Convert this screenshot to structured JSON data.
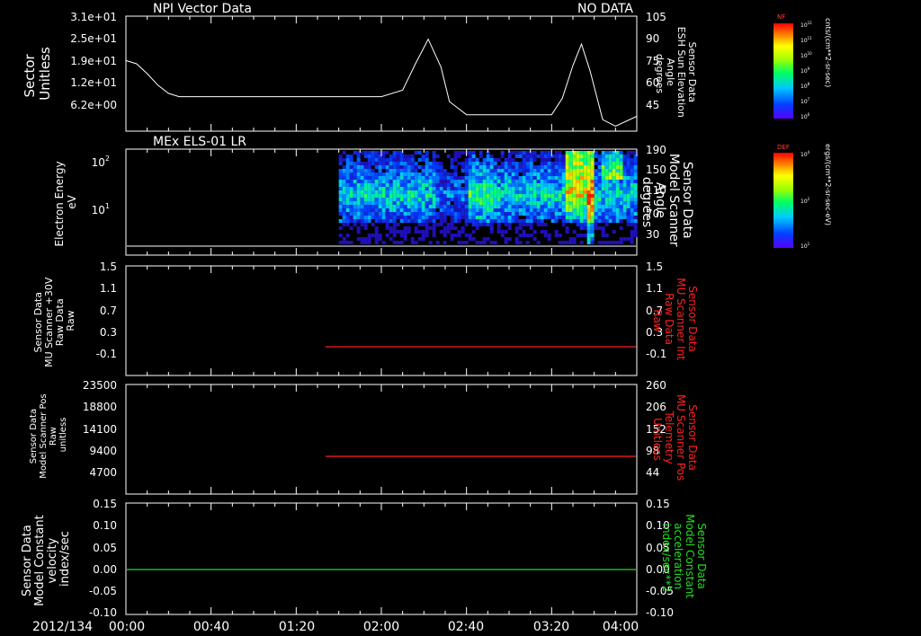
{
  "date_label": "2012/134",
  "time_ticks": [
    "00:00",
    "00:40",
    "01:20",
    "02:00",
    "02:40",
    "03:20",
    "04:00"
  ],
  "colors": {
    "background": "#000000",
    "foreground": "#ffffff",
    "red": "#ff2020",
    "green": "#20e020"
  },
  "panels": [
    {
      "id": "sector",
      "title_left": "NPI Vector Data",
      "title_right": "NO DATA",
      "ylabel_left": [
        "Sector",
        "Unitless"
      ],
      "ylabel_right": [
        "Sensor Data",
        "ESH Sun Elevation",
        "Angle",
        "degrees"
      ],
      "left_ticks": [
        "3.1e+01",
        "2.5e+01",
        "1.9e+01",
        "1.2e+01",
        "6.2e+00"
      ],
      "right_ticks": [
        "105",
        "90",
        "75",
        "60",
        "45"
      ]
    },
    {
      "id": "els",
      "title_left": "MEx ELS-01 LR",
      "ylabel_left": [
        "Electron Energy",
        "eV"
      ],
      "ylabel_right": [
        "Sensor Data",
        "Model Scanner",
        "Angle",
        "degrees"
      ],
      "left_ticks": [
        "10",
        "10"
      ],
      "left_tick_exponents": [
        "2",
        "1"
      ],
      "right_ticks": [
        "190",
        "150",
        "110",
        "70",
        "30"
      ]
    },
    {
      "id": "mu_raw",
      "ylabel_left": [
        "Sensor Data",
        "MU Scanner +30V",
        "Raw Data",
        "Raw"
      ],
      "ylabel_right": [
        "Sensor Data",
        "MU Scanner Int",
        "Raw Data",
        "Raw"
      ],
      "left_ticks": [
        "1.5",
        "1.1",
        "0.7",
        "0.3",
        "-0.1"
      ],
      "right_ticks": [
        "1.5",
        "1.1",
        "0.7",
        "0.3",
        "-0.1"
      ]
    },
    {
      "id": "pos",
      "ylabel_left": [
        "Sensor Data",
        "Model Scanner Pos",
        "Raw",
        "unitless"
      ],
      "ylabel_right": [
        "Sensor Data",
        "MU Scanner Pos",
        "Telemetry",
        "Unitless"
      ],
      "left_ticks": [
        "23500",
        "18800",
        "14100",
        "9400",
        "4700"
      ],
      "right_ticks": [
        "260",
        "206",
        "152",
        "98",
        "44"
      ]
    },
    {
      "id": "constant",
      "ylabel_left": [
        "Sensor Data",
        "Model Constant",
        "velocity",
        "index/sec"
      ],
      "ylabel_right": [
        "Sensor Data",
        "Model Constant",
        "acceleration",
        "index/sec**2"
      ],
      "left_ticks": [
        "0.15",
        "0.10",
        "0.05",
        "0.00",
        "-0.05",
        "-0.10"
      ],
      "right_ticks": [
        "0.15",
        "0.10",
        "0.05",
        "0.00",
        "-0.05",
        "-0.10"
      ]
    }
  ],
  "colorbars": [
    {
      "id": "nf",
      "label": "NF",
      "unit": "cnts/(cm**2-sr-sec)",
      "ticks": [
        "10",
        "10",
        "10",
        "10",
        "10",
        "10",
        "10"
      ],
      "tick_exponents": [
        "12",
        "11",
        "10",
        "9",
        "8",
        "7",
        "6"
      ]
    },
    {
      "id": "def",
      "label": "DEF",
      "unit": "ergs/(cm**2-sr-sec-eV)",
      "ticks": [
        "10",
        "10",
        "10"
      ],
      "tick_exponents": [
        "4",
        "2",
        "1"
      ]
    }
  ],
  "chart_data": [
    {
      "type": "line",
      "name": "panel-sector",
      "x_unit": "minutes after 00:00",
      "xlim": [
        0,
        240
      ],
      "y_right_label": "ESH Sun Elevation Angle (degrees)",
      "ylim_right": [
        35,
        105
      ],
      "x": [
        0,
        5,
        10,
        15,
        20,
        25,
        30,
        40,
        60,
        80,
        100,
        120,
        130,
        136,
        142,
        148,
        152,
        160,
        180,
        200,
        205,
        210,
        214,
        218,
        224,
        230,
        240
      ],
      "y": [
        78,
        76,
        70,
        63,
        58,
        56,
        56,
        56,
        56,
        56,
        56,
        56,
        60,
        76,
        91,
        74,
        53,
        45,
        45,
        45,
        55,
        75,
        88,
        72,
        42,
        38,
        44
      ]
    },
    {
      "type": "heatmap",
      "name": "panel-els-spectrogram",
      "x_unit": "minutes after 00:00",
      "xlim": [
        0,
        240
      ],
      "y_scale": "log",
      "data_start_minute": 100,
      "description_of_bands": "electron energy flux, strongest 5-30 eV, intermittent high-energy bursts near 03:30"
    },
    {
      "type": "line",
      "name": "panel-mu-raw",
      "xlim": [
        0,
        240
      ],
      "ylim": [
        -0.3,
        1.5
      ],
      "x": [
        95,
        240
      ],
      "y": [
        -0.07,
        -0.07
      ],
      "color": "red"
    },
    {
      "type": "line",
      "name": "panel-pos",
      "xlim": [
        0,
        240
      ],
      "ylim_right": [
        0,
        270
      ],
      "x": [
        95,
        240
      ],
      "y": [
        90,
        90
      ],
      "color": "red"
    },
    {
      "type": "line",
      "name": "panel-constant",
      "xlim": [
        0,
        240
      ],
      "ylim": [
        -0.1,
        0.15
      ],
      "x": [
        0,
        240
      ],
      "y": [
        0.0,
        0.0
      ],
      "color": "green"
    }
  ]
}
